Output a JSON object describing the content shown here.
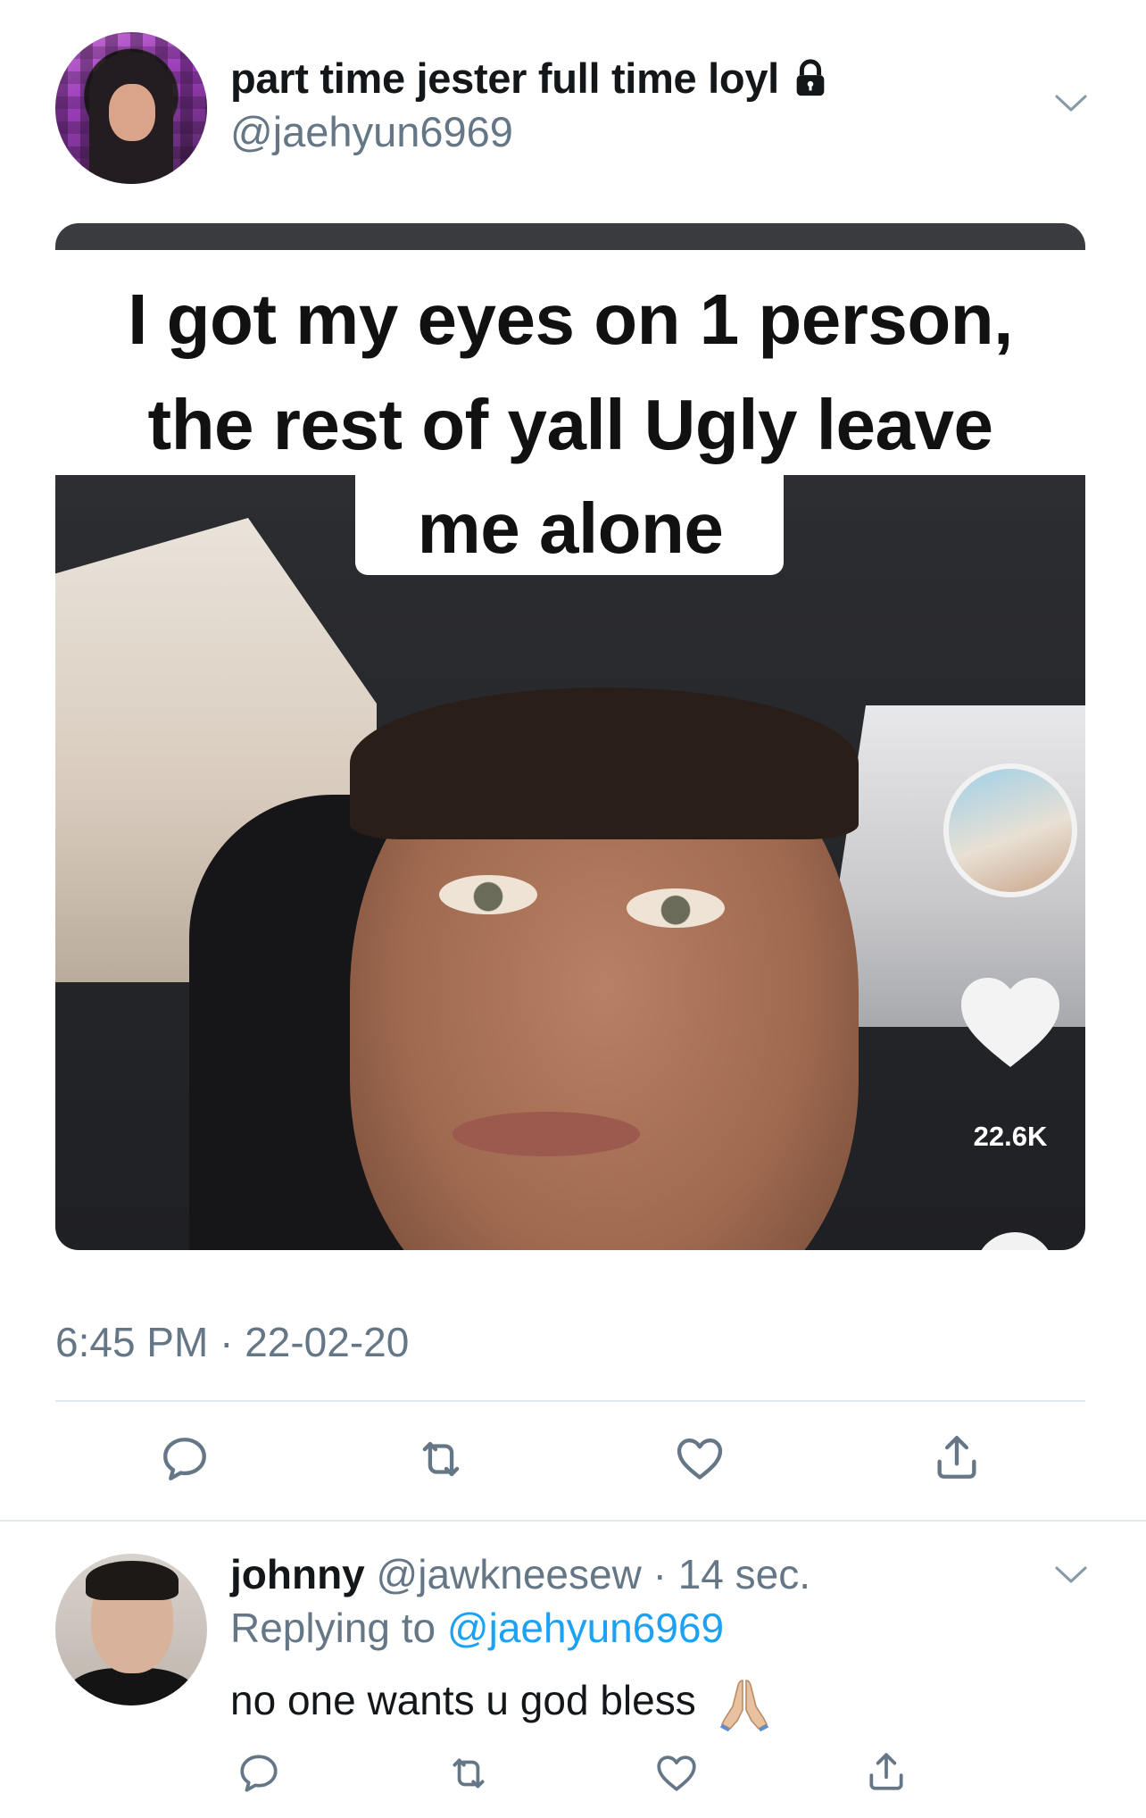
{
  "tweet": {
    "display_name": "part time jester full time loyl",
    "handle": "@jaehyun6969",
    "protected_icon": "lock-icon",
    "media": {
      "caption_line1": "I got my eyes on 1 person,",
      "caption_line2": "the rest of yall Ugly leave",
      "caption_line3": "me alone",
      "overlay_like_count": "22.6K",
      "overlay_icons": [
        "creator-avatar",
        "heart-icon"
      ]
    },
    "timestamp": "6:45 PM · 22-02-20",
    "actions": [
      "reply-icon",
      "retweet-icon",
      "like-icon",
      "share-icon"
    ]
  },
  "reply": {
    "display_name": "johnny",
    "handle": "@jawkneesew",
    "separator": "·",
    "time": "14 sec.",
    "replying_prefix": "Replying to",
    "replying_to": "@jaehyun6969",
    "text": "no one wants u god bless",
    "emoji": "folded-hands-emoji",
    "actions": [
      "reply-icon",
      "retweet-icon",
      "like-icon",
      "share-icon"
    ]
  },
  "colors": {
    "text_primary": "#14171a",
    "text_secondary": "#657786",
    "link": "#1da1f2",
    "divider": "#e1e8ed",
    "icon": "#657786"
  }
}
